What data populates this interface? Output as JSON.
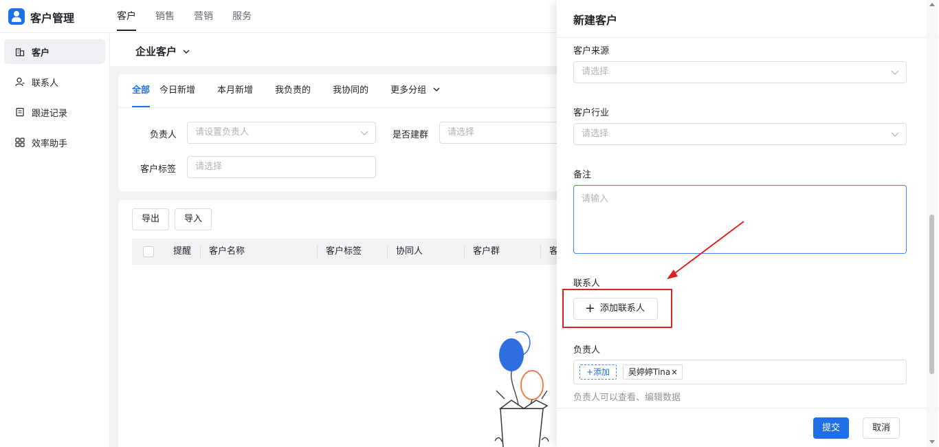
{
  "app": {
    "title": "客户管理"
  },
  "topnav": [
    {
      "label": "客户",
      "active": true
    },
    {
      "label": "销售",
      "active": false
    },
    {
      "label": "营销",
      "active": false
    },
    {
      "label": "服务",
      "active": false
    }
  ],
  "sidebar": {
    "items": [
      {
        "label": "客户",
        "icon": "building-icon",
        "active": true
      },
      {
        "label": "联系人",
        "icon": "contact-icon",
        "active": false
      },
      {
        "label": "跟进记录",
        "icon": "record-icon",
        "active": false
      },
      {
        "label": "效率助手",
        "icon": "apps-icon",
        "active": false
      }
    ]
  },
  "main": {
    "title": "企业客户",
    "tabs": [
      {
        "label": "全部",
        "active": true
      },
      {
        "label": "今日新增"
      },
      {
        "label": "本月新增"
      },
      {
        "label": "我负责的"
      },
      {
        "label": "我协同的"
      },
      {
        "label": "更多分组"
      }
    ],
    "filters": {
      "owner_label": "负责人",
      "owner_placeholder": "请设置负责人",
      "group_label": "是否建群",
      "group_placeholder": "请选择",
      "tag_label": "客户标签",
      "tag_placeholder": "请选择"
    },
    "export_label": "导出",
    "import_label": "导入",
    "columns": [
      "提醒",
      "客户名称",
      "客户标签",
      "协同人",
      "客户群",
      "客"
    ]
  },
  "panel": {
    "title": "新建客户",
    "source_label": "客户来源",
    "source_placeholder": "请选择",
    "industry_label": "客户行业",
    "industry_placeholder": "请选择",
    "remark_label": "备注",
    "remark_placeholder": "请输入",
    "contact_label": "联系人",
    "add_contact_label": "添加联系人",
    "owner_label": "负责人",
    "owner_add_label": "+添加",
    "owner_tag": "吴婷婷Tina",
    "owner_hint": "负责人可以查看、编辑数据",
    "submit_label": "提交",
    "cancel_label": "取消"
  },
  "colors": {
    "accent": "#1f6fe8",
    "annotation": "#e02020"
  }
}
